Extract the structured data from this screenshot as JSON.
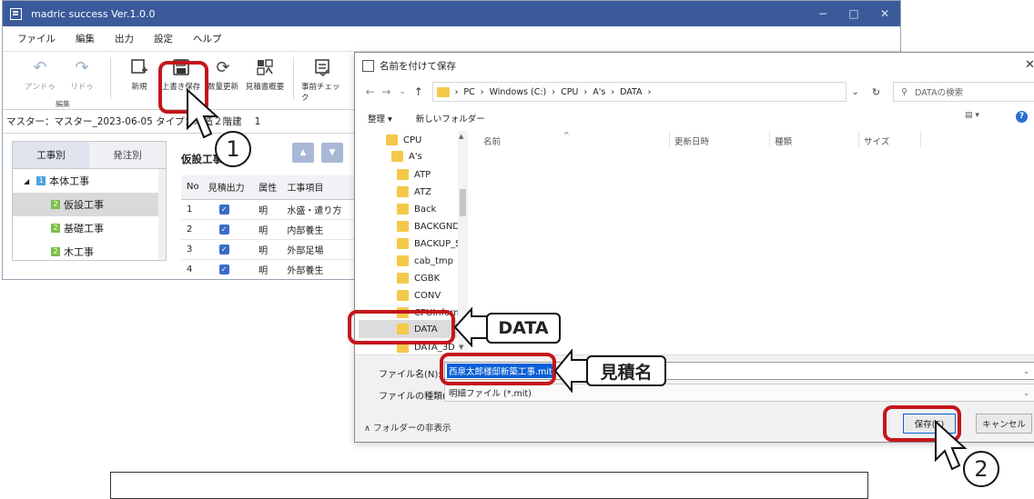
{
  "app": {
    "title": "madric success Ver.1.0.0",
    "window_controls": [
      "−",
      "□",
      "✕"
    ],
    "menu": [
      "ファイル",
      "編集",
      "出力",
      "設定",
      "ヘルプ"
    ],
    "ribbon": {
      "undo": "アンドゥ",
      "redo": "リドゥ",
      "group_label": "編集",
      "new": "新規",
      "overwrite_save": "上書き保存",
      "qty_update": "数量更新",
      "estimate_summary": "見積書概要",
      "pre_check": "事前チェック"
    },
    "infobar": "マスター：マスター_2023-06-05  タイプ：木造２階建",
    "infobar_tail": "1",
    "tree": {
      "tab_by_work": "工事別",
      "tab_by_order": "発注別",
      "root": "本体工事",
      "items": [
        "仮設工事",
        "基礎工事",
        "木工事"
      ],
      "badge_root": "1",
      "badge_child": "2"
    },
    "detail": {
      "title": "仮設工事",
      "headers": [
        "No",
        "見積出力",
        "属性",
        "工事項目"
      ],
      "rows": [
        {
          "no": "1",
          "attr": "明",
          "item": "水盛・遣り方"
        },
        {
          "no": "2",
          "attr": "明",
          "item": "内部養生"
        },
        {
          "no": "3",
          "attr": "明",
          "item": "外部足場"
        },
        {
          "no": "4",
          "attr": "明",
          "item": "外部養生"
        }
      ]
    }
  },
  "dialog": {
    "title": "名前を付けて保存",
    "breadcrumb": [
      "PC",
      "Windows (C:)",
      "CPU",
      "A's",
      "DATA"
    ],
    "search_placeholder": "DATAの検索",
    "organize": "整理 ▾",
    "new_folder": "新しいフォルダー",
    "columns": [
      "名前",
      "更新日時",
      "種類",
      "サイズ"
    ],
    "folders": [
      "CPU",
      "A's",
      "ATP",
      "ATZ",
      "Back",
      "BACKGND",
      "BACKUP_S",
      "cab_tmp",
      "CGBK",
      "CONV",
      "CPUInforma",
      "DATA",
      "DATA_3D"
    ],
    "filename_label": "ファイル名(N):",
    "filename_value": "西泉太郎様邸新築工事.mit",
    "filetype_label": "ファイルの種類(T):",
    "filetype_value": "明細ファイル (*.mit)",
    "hide_folders": "フォルダーの非表示",
    "save_button": "保存(S)",
    "cancel_button": "キャンセル"
  },
  "annotations": {
    "step1": "1",
    "step2": "2",
    "callout_data": "DATA",
    "callout_name": "見積名"
  },
  "colors": {
    "titlebar": "#3b5a9a",
    "highlight": "#c4161c",
    "selection": "#0a5fd6"
  }
}
